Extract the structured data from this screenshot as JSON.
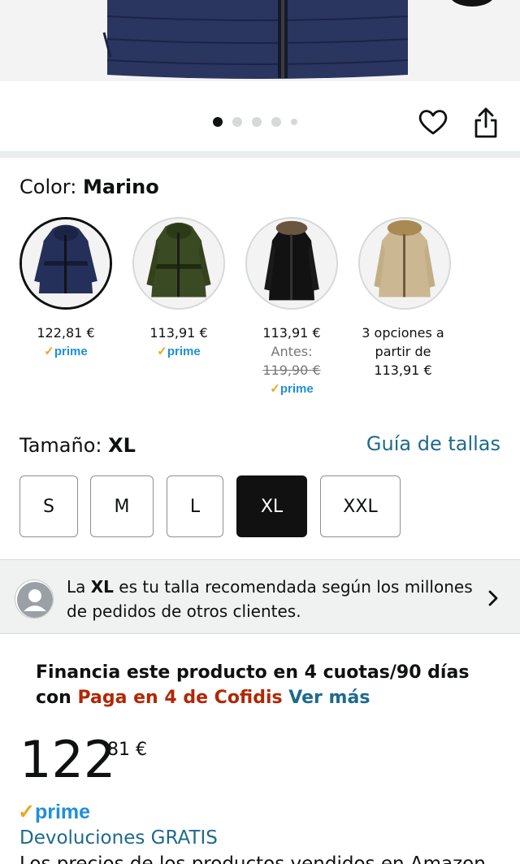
{
  "gallery": {
    "dot_count": 5,
    "active_index": 0,
    "favorite_icon": "heart-icon",
    "share_icon": "share-icon"
  },
  "color": {
    "label": "Color:",
    "selected": "Marino",
    "options": [
      {
        "name": "Marino",
        "price": "122,81 €",
        "prime": "prime",
        "swatch_color": "#25305a"
      },
      {
        "name": "Verde",
        "price": "113,91 €",
        "prime": "prime",
        "swatch_color": "#3a4a22"
      },
      {
        "name": "Negro",
        "price": "113,91 €",
        "before_label": "Antes:",
        "before_price": "119,90 €",
        "prime": "prime",
        "swatch_color": "#121212"
      },
      {
        "name": "Beige",
        "line1": "3 opciones a",
        "line2": "partir de",
        "line3": "113,91 €",
        "swatch_color": "#cbb893"
      }
    ]
  },
  "size": {
    "label": "Tamaño:",
    "selected": "XL",
    "guide_link": "Guía de tallas",
    "options": [
      "S",
      "M",
      "L",
      "XL",
      "XXL"
    ]
  },
  "recommendation": {
    "prefix": "La",
    "size": "XL",
    "text_line1": "es tu talla recomendada según los millones",
    "text_line2": "de pedidos de otros clientes."
  },
  "finance": {
    "line1": "Financia este producto en 4 cuotas/90 días",
    "con": "con",
    "provider": "Paga en 4 de Cofidis",
    "link": "Ver más"
  },
  "price": {
    "whole": "122",
    "fraction": "81",
    "currency": "€"
  },
  "prime_label": "prime",
  "returns": "Devoluciones GRATIS",
  "footer_cut": "Los precios de los productos vendidos en Amazon",
  "colors": {
    "link": "#1e6a8c",
    "prime_blue": "#1f8fd9",
    "prime_check": "#f0a41d",
    "cofidis": "#b12704"
  }
}
